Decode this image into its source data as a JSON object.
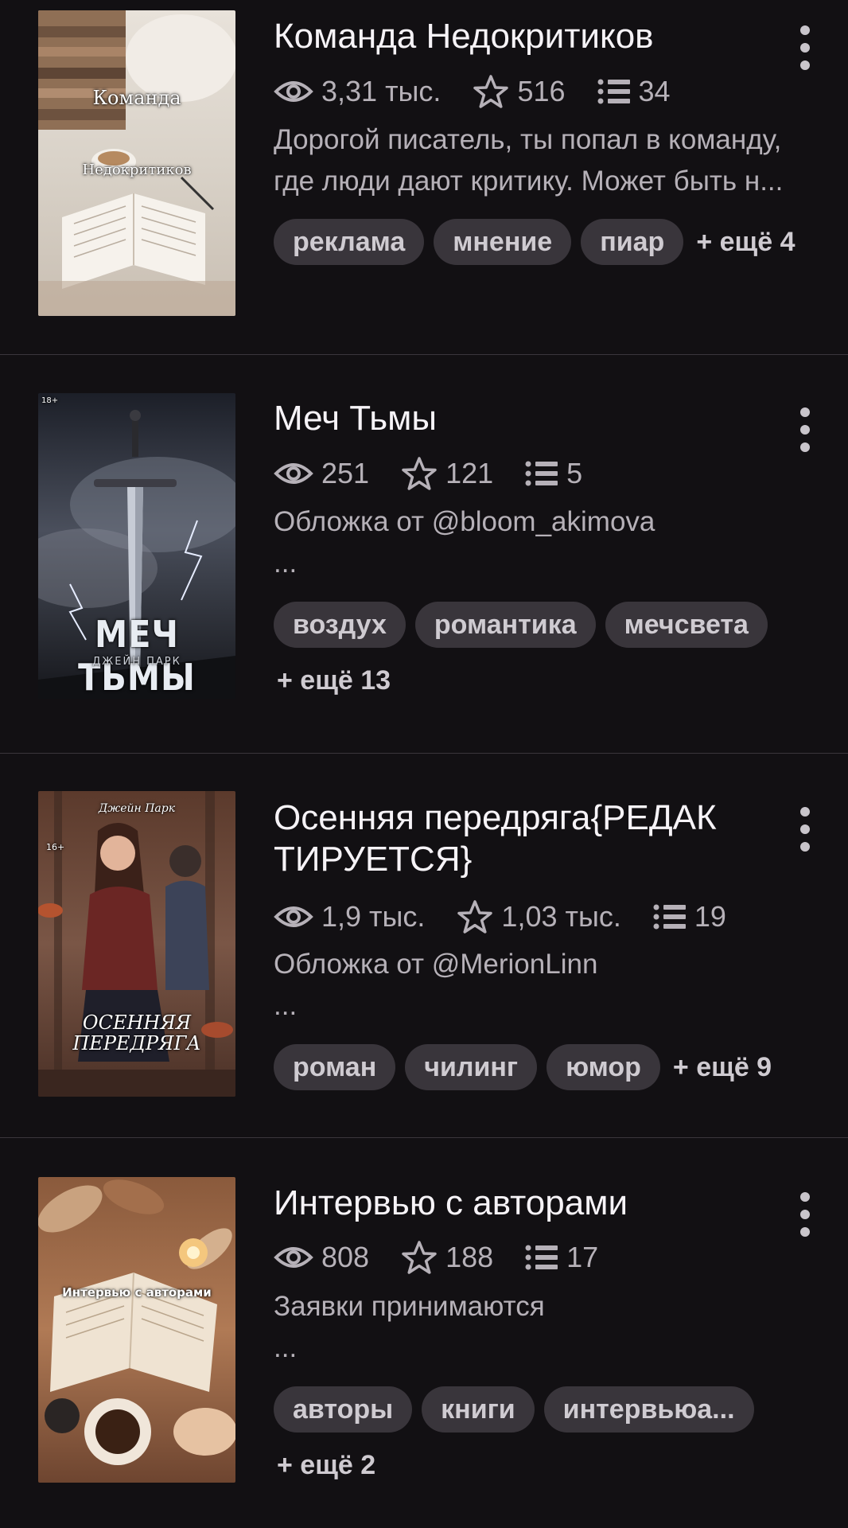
{
  "colors": {
    "background": "#121013",
    "tag_bg": "#39353b",
    "muted_text": "#b6b1b8",
    "divider": "#3a363c"
  },
  "icons": {
    "views": "eye-icon",
    "rating": "star-icon",
    "chapters": "list-icon",
    "menu": "more-vertical-icon"
  },
  "stories": [
    {
      "title": "Команда Недокритиков",
      "cover_text_top": "Команда",
      "cover_text_bottom": "Недокритиков",
      "views": "3,31 тыс.",
      "stars": "516",
      "chapters": "34",
      "description": "Дорогой писатель, ты попал в команду, где люди дают критику. Может быть н...",
      "tags": [
        "реклама",
        "мнение",
        "пиар"
      ],
      "more_tags": "+ ещё 4"
    },
    {
      "title": "Меч Тьмы",
      "cover_text_top": "МЕЧ ТЬМЫ",
      "cover_text_bottom": "ДЖЕЙН ПАРК",
      "cover_badge": "18+",
      "views": "251",
      "stars": "121",
      "chapters": "5",
      "description": "Обложка от @bloom_akimova\n...",
      "tags": [
        "воздух",
        "романтика",
        "мечсвета"
      ],
      "more_tags": "+ ещё 13"
    },
    {
      "title": "Осенняя передряга{РЕДАК ТИРУЕТСЯ}",
      "cover_text_top": "Джейн Парк",
      "cover_text_bottom": "ОСЕННЯЯ ПЕРЕДРЯГА",
      "cover_badge": "16+",
      "views": "1,9 тыс.",
      "stars": "1,03 тыс.",
      "chapters": "19",
      "description": "Обложка от @MerionLinn\n...",
      "tags": [
        "роман",
        "чилинг",
        "юмор"
      ],
      "more_tags": "+ ещё 9"
    },
    {
      "title": "Интервью с авторами",
      "cover_text_top": "Интервью с авторами",
      "views": "808",
      "stars": "188",
      "chapters": "17",
      "description": "Заявки принимаются\n...",
      "tags": [
        "авторы",
        "книги",
        "интервьюа..."
      ],
      "more_tags": "+ ещё 2"
    }
  ]
}
